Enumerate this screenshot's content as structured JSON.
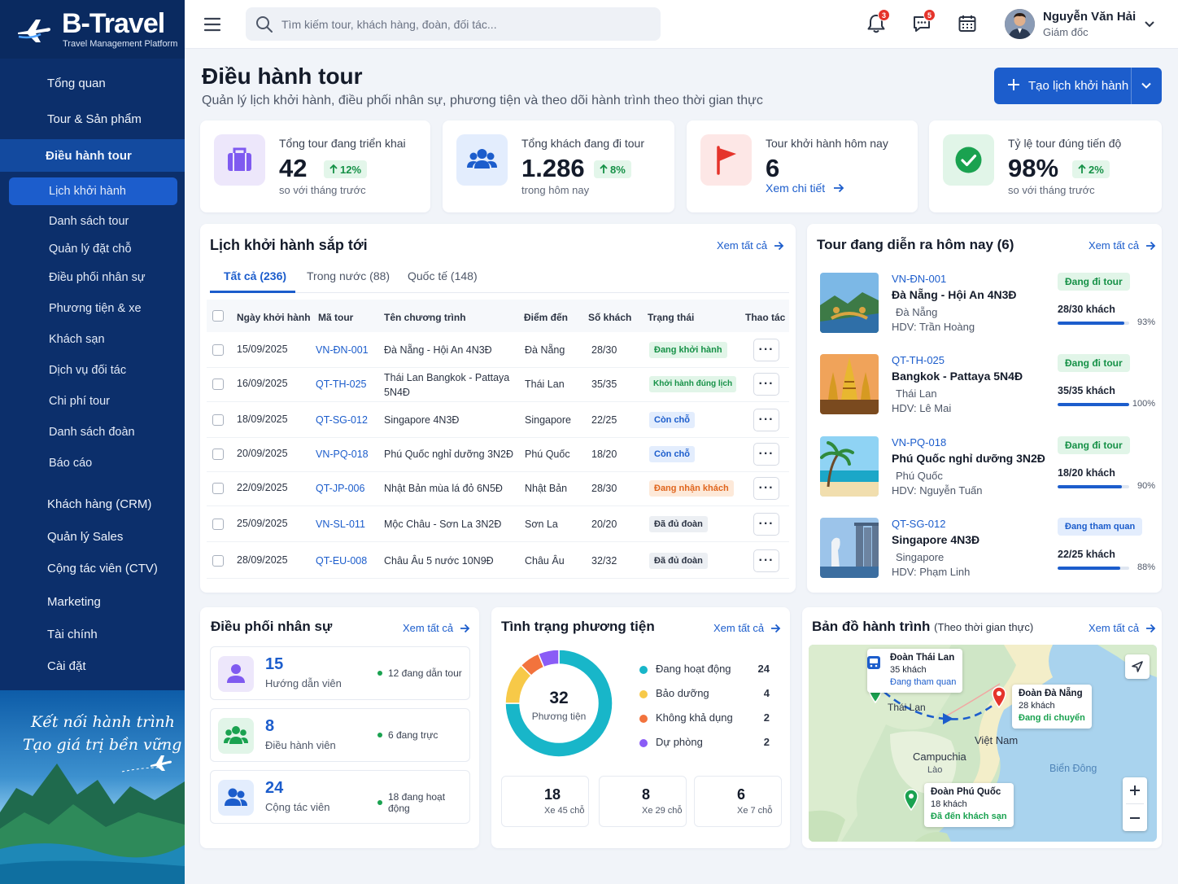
{
  "brand": {
    "name": "B-Travel",
    "tagline": "Travel Management Platform"
  },
  "sidebar": {
    "items": [
      {
        "label": "Tổng quan",
        "icon": "home-icon"
      },
      {
        "label": "Tour & Sản phẩm",
        "icon": "box-icon"
      },
      {
        "label": "Điều hành tour",
        "icon": "operations-icon"
      },
      {
        "label": "Khách hàng (CRM)",
        "icon": "customers-icon"
      },
      {
        "label": "Quản lý Sales",
        "icon": "sales-icon"
      },
      {
        "label": "Cộng tác viên (CTV)",
        "icon": "collaborators-icon"
      },
      {
        "label": "Marketing",
        "icon": "megaphone-icon"
      },
      {
        "label": "Tài chính",
        "icon": "finance-icon"
      },
      {
        "label": "Cài đặt",
        "icon": "gear-icon"
      }
    ],
    "sub_items": [
      {
        "label": "Lịch khởi hành",
        "icon": "calendar-icon"
      },
      {
        "label": "Danh sách tour",
        "icon": "list-icon"
      },
      {
        "label": "Quản lý đặt chỗ",
        "icon": "booking-icon"
      },
      {
        "label": "Điều phối nhân sự",
        "icon": "staff-icon"
      },
      {
        "label": "Phương tiện & xe",
        "icon": "car-icon"
      },
      {
        "label": "Khách sạn",
        "icon": "hotel-icon"
      },
      {
        "label": "Dịch vụ đối tác",
        "icon": "partner-icon"
      },
      {
        "label": "Chi phí tour",
        "icon": "cost-icon"
      },
      {
        "label": "Danh sách đoàn",
        "icon": "groups-icon"
      },
      {
        "label": "Báo cáo",
        "icon": "report-icon"
      }
    ],
    "promo": {
      "line1": "Kết nối hành trình",
      "line2": "Tạo giá trị bền vững"
    }
  },
  "topbar": {
    "search_placeholder": "Tìm kiếm tour, khách hàng, đoàn, đối tác...",
    "notifications_count": "3",
    "messages_count": "5",
    "user": {
      "name": "Nguyễn Văn Hải",
      "role": "Giám đốc"
    }
  },
  "page": {
    "title": "Điều hành tour",
    "subtitle": "Quản lý lịch khởi hành, điều phối nhân sự, phương tiện và theo dõi hành trình theo thời gian thực",
    "cta_label": "Tạo lịch khởi hành"
  },
  "kpis": [
    {
      "title": "Tổng tour đang triển khai",
      "value": "42",
      "change": "12%",
      "note": "so với tháng trước"
    },
    {
      "title": "Tổng khách đang đi tour",
      "value": "1.286",
      "change": "8%",
      "note": "trong hôm nay"
    },
    {
      "title": "Tour khởi hành hôm nay",
      "value": "6",
      "link": "Xem chi tiết"
    },
    {
      "title": "Tỷ lệ tour đúng tiến độ",
      "value": "98%",
      "change": "2%",
      "note": "so với tháng trước"
    }
  ],
  "schedule": {
    "title": "Lịch khởi hành sắp tới",
    "see_all": "Xem tất cả",
    "tabs": [
      "Tất cả (236)",
      "Trong nước (88)",
      "Quốc tế (148)"
    ],
    "columns": [
      "Ngày khởi hành",
      "Mã tour",
      "Tên chương trình",
      "Điểm đến",
      "Số khách",
      "Trạng thái",
      "Thao tác"
    ],
    "rows": [
      {
        "date": "15/09/2025",
        "code": "VN-ĐN-001",
        "name": "Đà Nẵng - Hội An 4N3Đ",
        "name2": "",
        "dest": "Đà Nẵng",
        "guests": "28/30",
        "status": "Đang khởi hành",
        "tone": "green"
      },
      {
        "date": "16/09/2025",
        "code": "QT-TH-025",
        "name": "Thái Lan Bangkok - Pattaya",
        "name2": "5N4Đ",
        "dest": "Thái Lan",
        "guests": "35/35",
        "status": "Khởi hành đúng lịch",
        "tone": "green"
      },
      {
        "date": "18/09/2025",
        "code": "QT-SG-012",
        "name": "Singapore 4N3Đ",
        "name2": "",
        "dest": "Singapore",
        "guests": "22/25",
        "status": "Còn chỗ",
        "tone": "blue"
      },
      {
        "date": "20/09/2025",
        "code": "VN-PQ-018",
        "name": "Phú Quốc nghỉ dưỡng 3N2Đ",
        "name2": "",
        "dest": "Phú Quốc",
        "guests": "18/20",
        "status": "Còn chỗ",
        "tone": "blue"
      },
      {
        "date": "22/09/2025",
        "code": "QT-JP-006",
        "name": "Nhật Bản mùa lá đỏ 6N5Đ",
        "name2": "",
        "dest": "Nhật Bản",
        "guests": "28/30",
        "status": "Đang nhận khách",
        "tone": "orange"
      },
      {
        "date": "25/09/2025",
        "code": "VN-SL-011",
        "name": "Mộc Châu - Sơn La 3N2Đ",
        "name2": "",
        "dest": "Sơn La",
        "guests": "20/20",
        "status": "Đã đủ đoàn",
        "tone": "gray"
      },
      {
        "date": "28/09/2025",
        "code": "QT-EU-008",
        "name": "Châu Âu 5 nước 10N9Đ",
        "name2": "",
        "dest": "Châu Âu",
        "guests": "32/32",
        "status": "Đã đủ đoàn",
        "tone": "gray"
      }
    ]
  },
  "today": {
    "title": "Tour đang diễn ra hôm nay (6)",
    "see_all": "Xem tất cả",
    "items": [
      {
        "code": "VN-ĐN-001",
        "name": "Đà Nẵng - Hội An 4N3Đ",
        "loc": "Đà Nẵng",
        "hdv": "HDV: Trần Hoàng",
        "status": "Đang đi tour",
        "tone": "green",
        "guests": "28/30 khách",
        "pct": "93%",
        "fill": 0.93
      },
      {
        "code": "QT-TH-025",
        "name": "Bangkok - Pattaya 5N4Đ",
        "loc": "Thái Lan",
        "hdv": "HDV: Lê Mai",
        "status": "Đang đi tour",
        "tone": "green",
        "guests": "35/35 khách",
        "pct": "100%",
        "fill": 1.0
      },
      {
        "code": "VN-PQ-018",
        "name": "Phú Quốc nghỉ dưỡng 3N2Đ",
        "loc": "Phú Quốc",
        "hdv": "HDV: Nguyễn Tuấn",
        "status": "Đang đi tour",
        "tone": "green",
        "guests": "18/20 khách",
        "pct": "90%",
        "fill": 0.9
      },
      {
        "code": "QT-SG-012",
        "name": "Singapore 4N3Đ",
        "loc": "Singapore",
        "hdv": "HDV: Phạm Linh",
        "status": "Đang tham quan",
        "tone": "blue",
        "guests": "22/25 khách",
        "pct": "88%",
        "fill": 0.88
      }
    ]
  },
  "staff": {
    "title": "Điều phối nhân sự",
    "see_all": "Xem tất cả",
    "items": [
      {
        "value": "15",
        "label": "Hướng dẫn viên",
        "note": "12 đang dẫn tour"
      },
      {
        "value": "8",
        "label": "Điều hành viên",
        "note": "6 đang trực"
      },
      {
        "value": "24",
        "label": "Cộng tác viên",
        "note": "18 đang hoạt động"
      }
    ]
  },
  "vehicles": {
    "title": "Tình trạng phương tiện",
    "see_all": "Xem tất cả",
    "total": "32",
    "total_label": "Phương tiện",
    "legend": [
      {
        "label": "Đang hoạt động",
        "value": "24",
        "color": "#18b6c9"
      },
      {
        "label": "Bảo dưỡng",
        "value": "4",
        "color": "#f7c948"
      },
      {
        "label": "Không khả dụng",
        "value": "2",
        "color": "#f2733d"
      },
      {
        "label": "Dự phòng",
        "value": "2",
        "color": "#8a5cf6"
      }
    ],
    "types": [
      {
        "value": "18",
        "label": "Xe 45 chỗ"
      },
      {
        "value": "8",
        "label": "Xe 29 chỗ"
      },
      {
        "value": "6",
        "label": "Xe 7 chỗ"
      }
    ]
  },
  "map": {
    "title": "Bản đồ hành trình",
    "title_note": "(Theo thời gian thực)",
    "see_all": "Xem tất cả",
    "places": [
      "Thái Lan",
      "Việt Nam",
      "Campuchia",
      "Lào",
      "Biển Đông"
    ],
    "groups": [
      {
        "name": "Đoàn Thái Lan",
        "count": "35 khách",
        "status": "Đang tham quan"
      },
      {
        "name": "Đoàn Đà Nẵng",
        "count": "28 khách",
        "status": "Đang di chuyển"
      },
      {
        "name": "Đoàn Phú Quốc",
        "count": "18 khách",
        "status": "Đã đến khách sạn"
      }
    ]
  }
}
